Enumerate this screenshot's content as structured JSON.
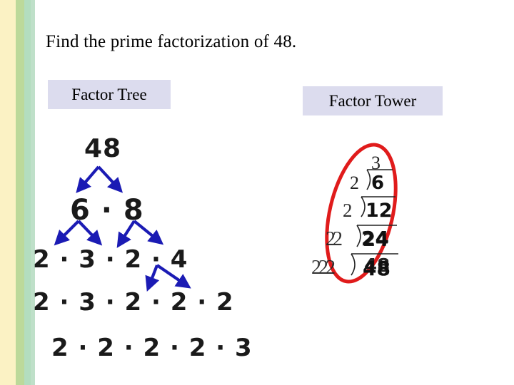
{
  "slide": {
    "background_color": "#ffffff",
    "title": "Find the prime factorization of 48."
  },
  "decor": {
    "stripes": [
      {
        "name": "cream-stripe",
        "color": "#fbf2c4"
      },
      {
        "name": "green-stripe",
        "color": "#bcd99a"
      },
      {
        "name": "mint-stripe",
        "color": "#b3ddbf"
      },
      {
        "name": "pale-mint-stripe",
        "color": "#bfe0c9"
      }
    ]
  },
  "labels": {
    "factor_tree": "Factor Tree",
    "factor_tower": "Factor Tower",
    "box_color": "#dcdcee"
  },
  "factor_tree": {
    "arrow_color": "#1b1bb4",
    "rows": [
      {
        "id": "row-0",
        "text": "48"
      },
      {
        "id": "row-1",
        "text": "6 · 8"
      },
      {
        "id": "row-2",
        "text": "2 · 3 · 2 · 4"
      },
      {
        "id": "row-3",
        "text": "2 · 3 · 2 · 2 · 2"
      },
      {
        "id": "row-4",
        "text": "2 · 2 · 2 · 2 · 3"
      }
    ]
  },
  "factor_tower": {
    "circle_color": "#e01b1b",
    "top_quotient": "3",
    "steps": [
      {
        "divisor": "2",
        "dividend": "6"
      },
      {
        "divisor": "2",
        "dividend": "12"
      },
      {
        "divisor": "2",
        "dividend": "24"
      },
      {
        "divisor": "2",
        "dividend": "48"
      }
    ],
    "ghost_divisors_row3": "22",
    "ghost_divisors_row4": "222",
    "ghost_dividend_row3": "24",
    "ghost_dividend_row4": "48"
  }
}
